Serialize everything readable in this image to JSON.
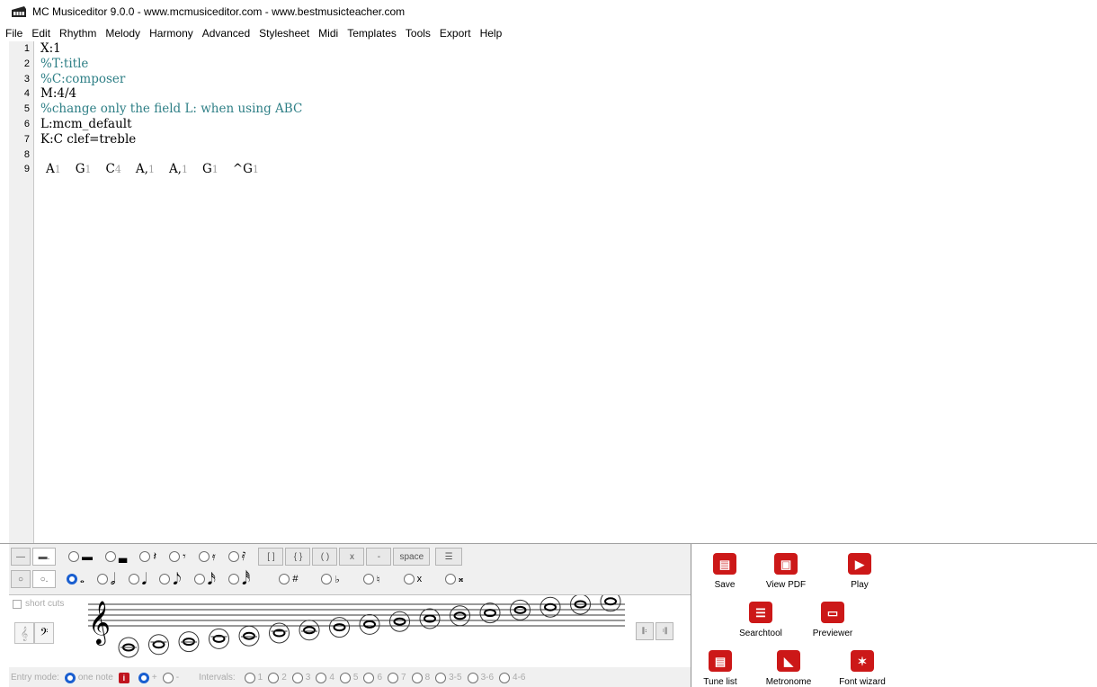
{
  "window": {
    "title": "MC Musiceditor 9.0.0 - www.mcmusiceditor.com - www.bestmusicteacher.com"
  },
  "menu": [
    "File",
    "Edit",
    "Rhythm",
    "Melody",
    "Harmony",
    "Advanced",
    "Stylesheet",
    "Midi",
    "Templates",
    "Tools",
    "Export",
    "Help"
  ],
  "editor": {
    "line_numbers": [
      "1",
      "2",
      "3",
      "4",
      "5",
      "6",
      "7",
      "8",
      "9"
    ],
    "lines": [
      {
        "text": "X:1",
        "type": "code"
      },
      {
        "text": "%T:title",
        "type": "comment"
      },
      {
        "text": "%C:composer",
        "type": "comment"
      },
      {
        "text": "M:4/4",
        "type": "code"
      },
      {
        "text": "%change only the field L: when using ABC",
        "type": "comment"
      },
      {
        "text": "L:mcm_default",
        "type": "code"
      },
      {
        "text": "K:C clef=treble",
        "type": "code"
      },
      {
        "text": "",
        "type": "code"
      }
    ],
    "notes_line": [
      {
        "n": "A",
        "d": "1"
      },
      {
        "n": "G",
        "d": "1"
      },
      {
        "n": "C",
        "d": "4"
      },
      {
        "n": "A,",
        "d": "1"
      },
      {
        "n": "A,",
        "d": "1"
      },
      {
        "n": "G",
        "d": "1"
      },
      {
        "n": "^G",
        "d": "1"
      }
    ]
  },
  "palette": {
    "row1_buttons": [
      "[ ]",
      "{ }",
      "( )",
      "x",
      "-",
      "space"
    ],
    "row2_accidentals": [
      "#",
      "♭",
      "♮",
      "x",
      "𝄪"
    ],
    "short_cuts_label": "short cuts",
    "entry_mode_label": "Entry mode:",
    "entry_one_note": "one note",
    "entry_info_badge": "i",
    "plus_label": "+",
    "minus_label": "-",
    "intervals_label": "Intervals:",
    "intervals": [
      "1",
      "2",
      "3",
      "4",
      "5",
      "6",
      "7",
      "8",
      "3-5",
      "3-6",
      "4-6"
    ]
  },
  "tools": [
    {
      "label": "Save",
      "icon": "save-icon"
    },
    {
      "label": "View PDF",
      "icon": "pdf-icon"
    },
    {
      "label": "Play",
      "icon": "play-icon"
    },
    {
      "label": "Searchtool",
      "icon": "database-icon"
    },
    {
      "label": "Previewer",
      "icon": "monitor-icon"
    },
    {
      "label": "Tune list",
      "icon": "list-icon"
    },
    {
      "label": "Metronome",
      "icon": "metronome-icon"
    },
    {
      "label": "Font wizard",
      "icon": "wand-icon"
    }
  ],
  "colors": {
    "accent_red": "#cc1818",
    "radio_blue": "#1a5fd0",
    "comment_teal": "#2e7f86"
  }
}
